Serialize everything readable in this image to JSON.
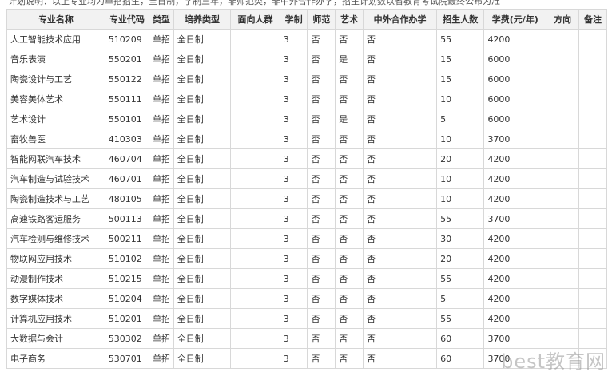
{
  "header_text": "计划说明：以上专业均为单招招生，全日制，学制三年，非师范类，非中外合作办学，招生计划数以省教育考试院最终公布为准",
  "table": {
    "columns": [
      "专业名称",
      "专业代码",
      "类型",
      "培养类型",
      "面向人群",
      "学制",
      "师范",
      "艺术",
      "中外合作办学",
      "招生人数",
      "学费(元/年)",
      "方向",
      "备注"
    ],
    "rows": [
      [
        "人工智能技术应用",
        "510209",
        "单招",
        "全日制",
        "",
        "3",
        "否",
        "否",
        "否",
        "55",
        "4200",
        "",
        ""
      ],
      [
        "音乐表演",
        "550201",
        "单招",
        "全日制",
        "",
        "3",
        "否",
        "是",
        "否",
        "15",
        "6000",
        "",
        ""
      ],
      [
        "陶瓷设计与工艺",
        "550122",
        "单招",
        "全日制",
        "",
        "3",
        "否",
        "否",
        "否",
        "15",
        "6000",
        "",
        ""
      ],
      [
        "美容美体艺术",
        "550111",
        "单招",
        "全日制",
        "",
        "3",
        "否",
        "否",
        "否",
        "10",
        "6000",
        "",
        ""
      ],
      [
        "艺术设计",
        "550101",
        "单招",
        "全日制",
        "",
        "3",
        "否",
        "是",
        "否",
        "5",
        "6000",
        "",
        ""
      ],
      [
        "畜牧兽医",
        "410303",
        "单招",
        "全日制",
        "",
        "3",
        "否",
        "否",
        "否",
        "10",
        "3700",
        "",
        ""
      ],
      [
        "智能网联汽车技术",
        "460704",
        "单招",
        "全日制",
        "",
        "3",
        "否",
        "否",
        "否",
        "20",
        "4200",
        "",
        ""
      ],
      [
        "汽车制造与试验技术",
        "460701",
        "单招",
        "全日制",
        "",
        "3",
        "否",
        "否",
        "否",
        "10",
        "4200",
        "",
        ""
      ],
      [
        "陶瓷制造技术与工艺",
        "480105",
        "单招",
        "全日制",
        "",
        "3",
        "否",
        "否",
        "否",
        "10",
        "4200",
        "",
        ""
      ],
      [
        "高速铁路客运服务",
        "500113",
        "单招",
        "全日制",
        "",
        "3",
        "否",
        "否",
        "否",
        "55",
        "3700",
        "",
        ""
      ],
      [
        "汽车检测与维修技术",
        "500211",
        "单招",
        "全日制",
        "",
        "3",
        "否",
        "否",
        "否",
        "30",
        "4200",
        "",
        ""
      ],
      [
        "物联网应用技术",
        "510102",
        "单招",
        "全日制",
        "",
        "3",
        "否",
        "否",
        "否",
        "20",
        "4200",
        "",
        ""
      ],
      [
        "动漫制作技术",
        "510215",
        "单招",
        "全日制",
        "",
        "3",
        "否",
        "否",
        "否",
        "55",
        "4200",
        "",
        ""
      ],
      [
        "数字媒体技术",
        "510204",
        "单招",
        "全日制",
        "",
        "3",
        "否",
        "否",
        "否",
        "5",
        "4200",
        "",
        ""
      ],
      [
        "计算机应用技术",
        "510201",
        "单招",
        "全日制",
        "",
        "3",
        "否",
        "否",
        "否",
        "55",
        "4200",
        "",
        ""
      ],
      [
        "大数据与会计",
        "530302",
        "单招",
        "全日制",
        "",
        "3",
        "否",
        "否",
        "否",
        "60",
        "3700",
        "",
        ""
      ],
      [
        "电子商务",
        "530701",
        "单招",
        "全日制",
        "",
        "3",
        "否",
        "否",
        "否",
        "60",
        "3700",
        "",
        ""
      ]
    ]
  },
  "watermark": "best教育网"
}
